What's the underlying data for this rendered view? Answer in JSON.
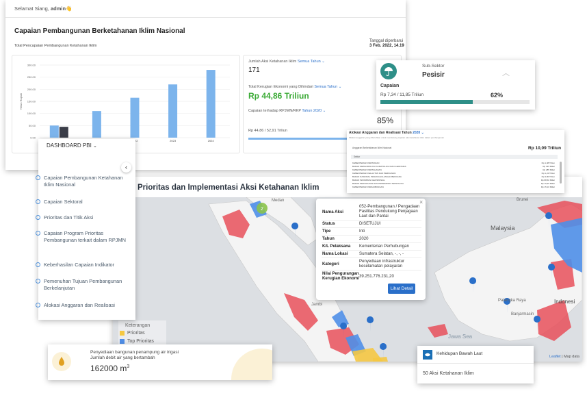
{
  "greeting": {
    "prefix": "Selamat Siang, ",
    "user": "admin",
    "emoji": "👋"
  },
  "overview": {
    "title": "Capaian Pembangunan Berketahanan Iklim Nasional",
    "chart_title": "Total Pencapaian Pembangunan Ketahanan Iklim",
    "updated_label": "Tanggal diperbarui",
    "updated_value": "3 Feb. 2022, 14.19"
  },
  "chart_data": {
    "type": "bar",
    "categories": [
      "2020",
      "2021",
      "2022",
      "2023",
      "2024"
    ],
    "series": [
      {
        "name": "",
        "color": "#7cb4ec",
        "values": [
          50,
          110,
          165,
          220,
          280
        ]
      },
      {
        "name": "",
        "color": "#3a3d48",
        "values": [
          44.86,
          null,
          null,
          null,
          null
        ]
      }
    ],
    "ylabel": "Triliun Rupiah",
    "yticks": [
      "0.00",
      "50.00",
      "100.00",
      "150.00",
      "200.00",
      "250.00",
      "300.00"
    ],
    "ylim": [
      0,
      300
    ],
    "grid": true
  },
  "stats": {
    "count_label": "Jumlah Aksi Ketahanan Iklim",
    "count_filter": "Semua Tahun",
    "count_value": "171",
    "loss_label": "Total Kerugian Ekonomi yang Dihindari",
    "loss_filter": "Semua Tahun",
    "loss_value": "Rp 44,86 Triliun",
    "rpjmn_label": "Capaian terhadap RPJMN/RKP",
    "rpjmn_filter": "Tahun 2020",
    "rpjmn_percent": "85%",
    "rpjmn_amount": "Rp 44,86 / 52,91 Triliun",
    "rpjmn_fraction": 0.85
  },
  "subsector": {
    "label": "Sub-Sektor",
    "name": "Pesisir",
    "capaian_label": "Capaian",
    "amount": "Rp 7,34 / 11,85 Triliun",
    "percent": "62%",
    "fraction": 0.62,
    "accent": "#2e8f88"
  },
  "budget": {
    "title": "Alokasi Anggaran dan Realisasi Tahun",
    "year": "2020",
    "subtitle": "Silakan anggaran yang dibutuhkan untuk mendukung capaian aksi ketahanan iklim dalam pembangunan",
    "total_label": "Anggaran Berketahanan Iklim Nasional",
    "total_value": "Rp 10,09 Triliun",
    "header": "Sektor",
    "rows": [
      {
        "name": "KEMENTERIAN PERTANIAN",
        "value": "Rp 1,08 Triliun"
      },
      {
        "name": "BADAN METEOROLOGI KLIMATOLOGI DAN GEOFISIKA",
        "value": "Rp 345 Miliar"
      },
      {
        "name": "KEMENTERIAN PERTAHANAN",
        "value": "Rp 285 Miliar"
      },
      {
        "name": "KEMENTERIAN KELAUTAN DAN PERIKANAN",
        "value": "Rp 1,24 Triliun"
      },
      {
        "name": "BADAN NASIONAL PENANGGULANGAN BENCANA",
        "value": "Rp 3,80 Triliun"
      },
      {
        "name": "BADAN INFORMASI GEOSPASIAL",
        "value": "Rp 88,60 Miliar"
      },
      {
        "name": "BADAN PENGKAJIAN DAN PENERAPAN TEKNOLOGI",
        "value": "Rp 19,45 Miliar"
      },
      {
        "name": "KEMENTERIAN PERHUBUNGAN",
        "value": "Rp 15,10 Miliar"
      }
    ]
  },
  "sidebar": {
    "dashboard_label": "DASHBOARD PBI",
    "items": [
      {
        "label": "Capaian Pembangunan Ketahanan Iklim Nasional"
      },
      {
        "label": "Capaian Sektoral"
      },
      {
        "label": "Prioritas dan Titik Aksi"
      },
      {
        "label": "Capaian Program Prioritas Pembangunan terkait dalam RPJMN"
      },
      {
        "label": "Keberhasilan Capaian Indikator"
      },
      {
        "label": "Pemenuhan Tujuan Pembangunan Berkelanjutan"
      },
      {
        "label": "Alokasi Anggaran dan Realisasi"
      }
    ]
  },
  "map": {
    "title": "Prioritas dan Implementasi Aksi Ketahanan Iklim",
    "labels": {
      "malaysia": "Malaysia",
      "medan": "Medan",
      "palangka": "Palangka Raya",
      "banjarmasin": "Banjarmasin",
      "brunei": "Brunei",
      "indonesia": "Indonesi",
      "jawa": "Jawa Sea",
      "jambi": "Jambi"
    },
    "cluster_count": "2",
    "attribution_leaflet": "Leaflet",
    "attribution_map": "Map data",
    "legend": {
      "title": "Keterangan",
      "items": [
        {
          "label": "Prioritas",
          "color": "#f5c842"
        },
        {
          "label": "Top Prioritas",
          "color": "#4f8fe8"
        }
      ]
    },
    "popup": {
      "rows": [
        {
          "key": "Nama Aksi",
          "value": "052-Pembangunan / Pengadaan Fasilitas Pendukung Penjagaan Laut dan Pantai"
        },
        {
          "key": "Status",
          "value": "DISETUJUI"
        },
        {
          "key": "Tipe",
          "value": "Inti"
        },
        {
          "key": "Tahun",
          "value": "2020"
        },
        {
          "key": "K/L Pelaksana",
          "value": "Kementerian Perhubungan"
        },
        {
          "key": "Nama Lokasi",
          "value": "Sumatera Selatan, -, -, -"
        },
        {
          "key": "Kategori",
          "value": "Penyediaan infrastruktur keselamatan pelayaran"
        },
        {
          "key": "Nilai Pengurangan Kerugian Ekonomi",
          "value": "39.251.776.231,20"
        }
      ],
      "button": "Lihat Detail",
      "close": "×"
    }
  },
  "water_card": {
    "label": "Penyediaan bangunan penampung air irigasi",
    "sub": "Jumlah debit air yang bertambah",
    "value": "162000 m",
    "unit_sup": "3"
  },
  "sea_card": {
    "label": "Kehidupan Bawah Laut",
    "count": "50 Aksi Ketahanan Iklim"
  }
}
